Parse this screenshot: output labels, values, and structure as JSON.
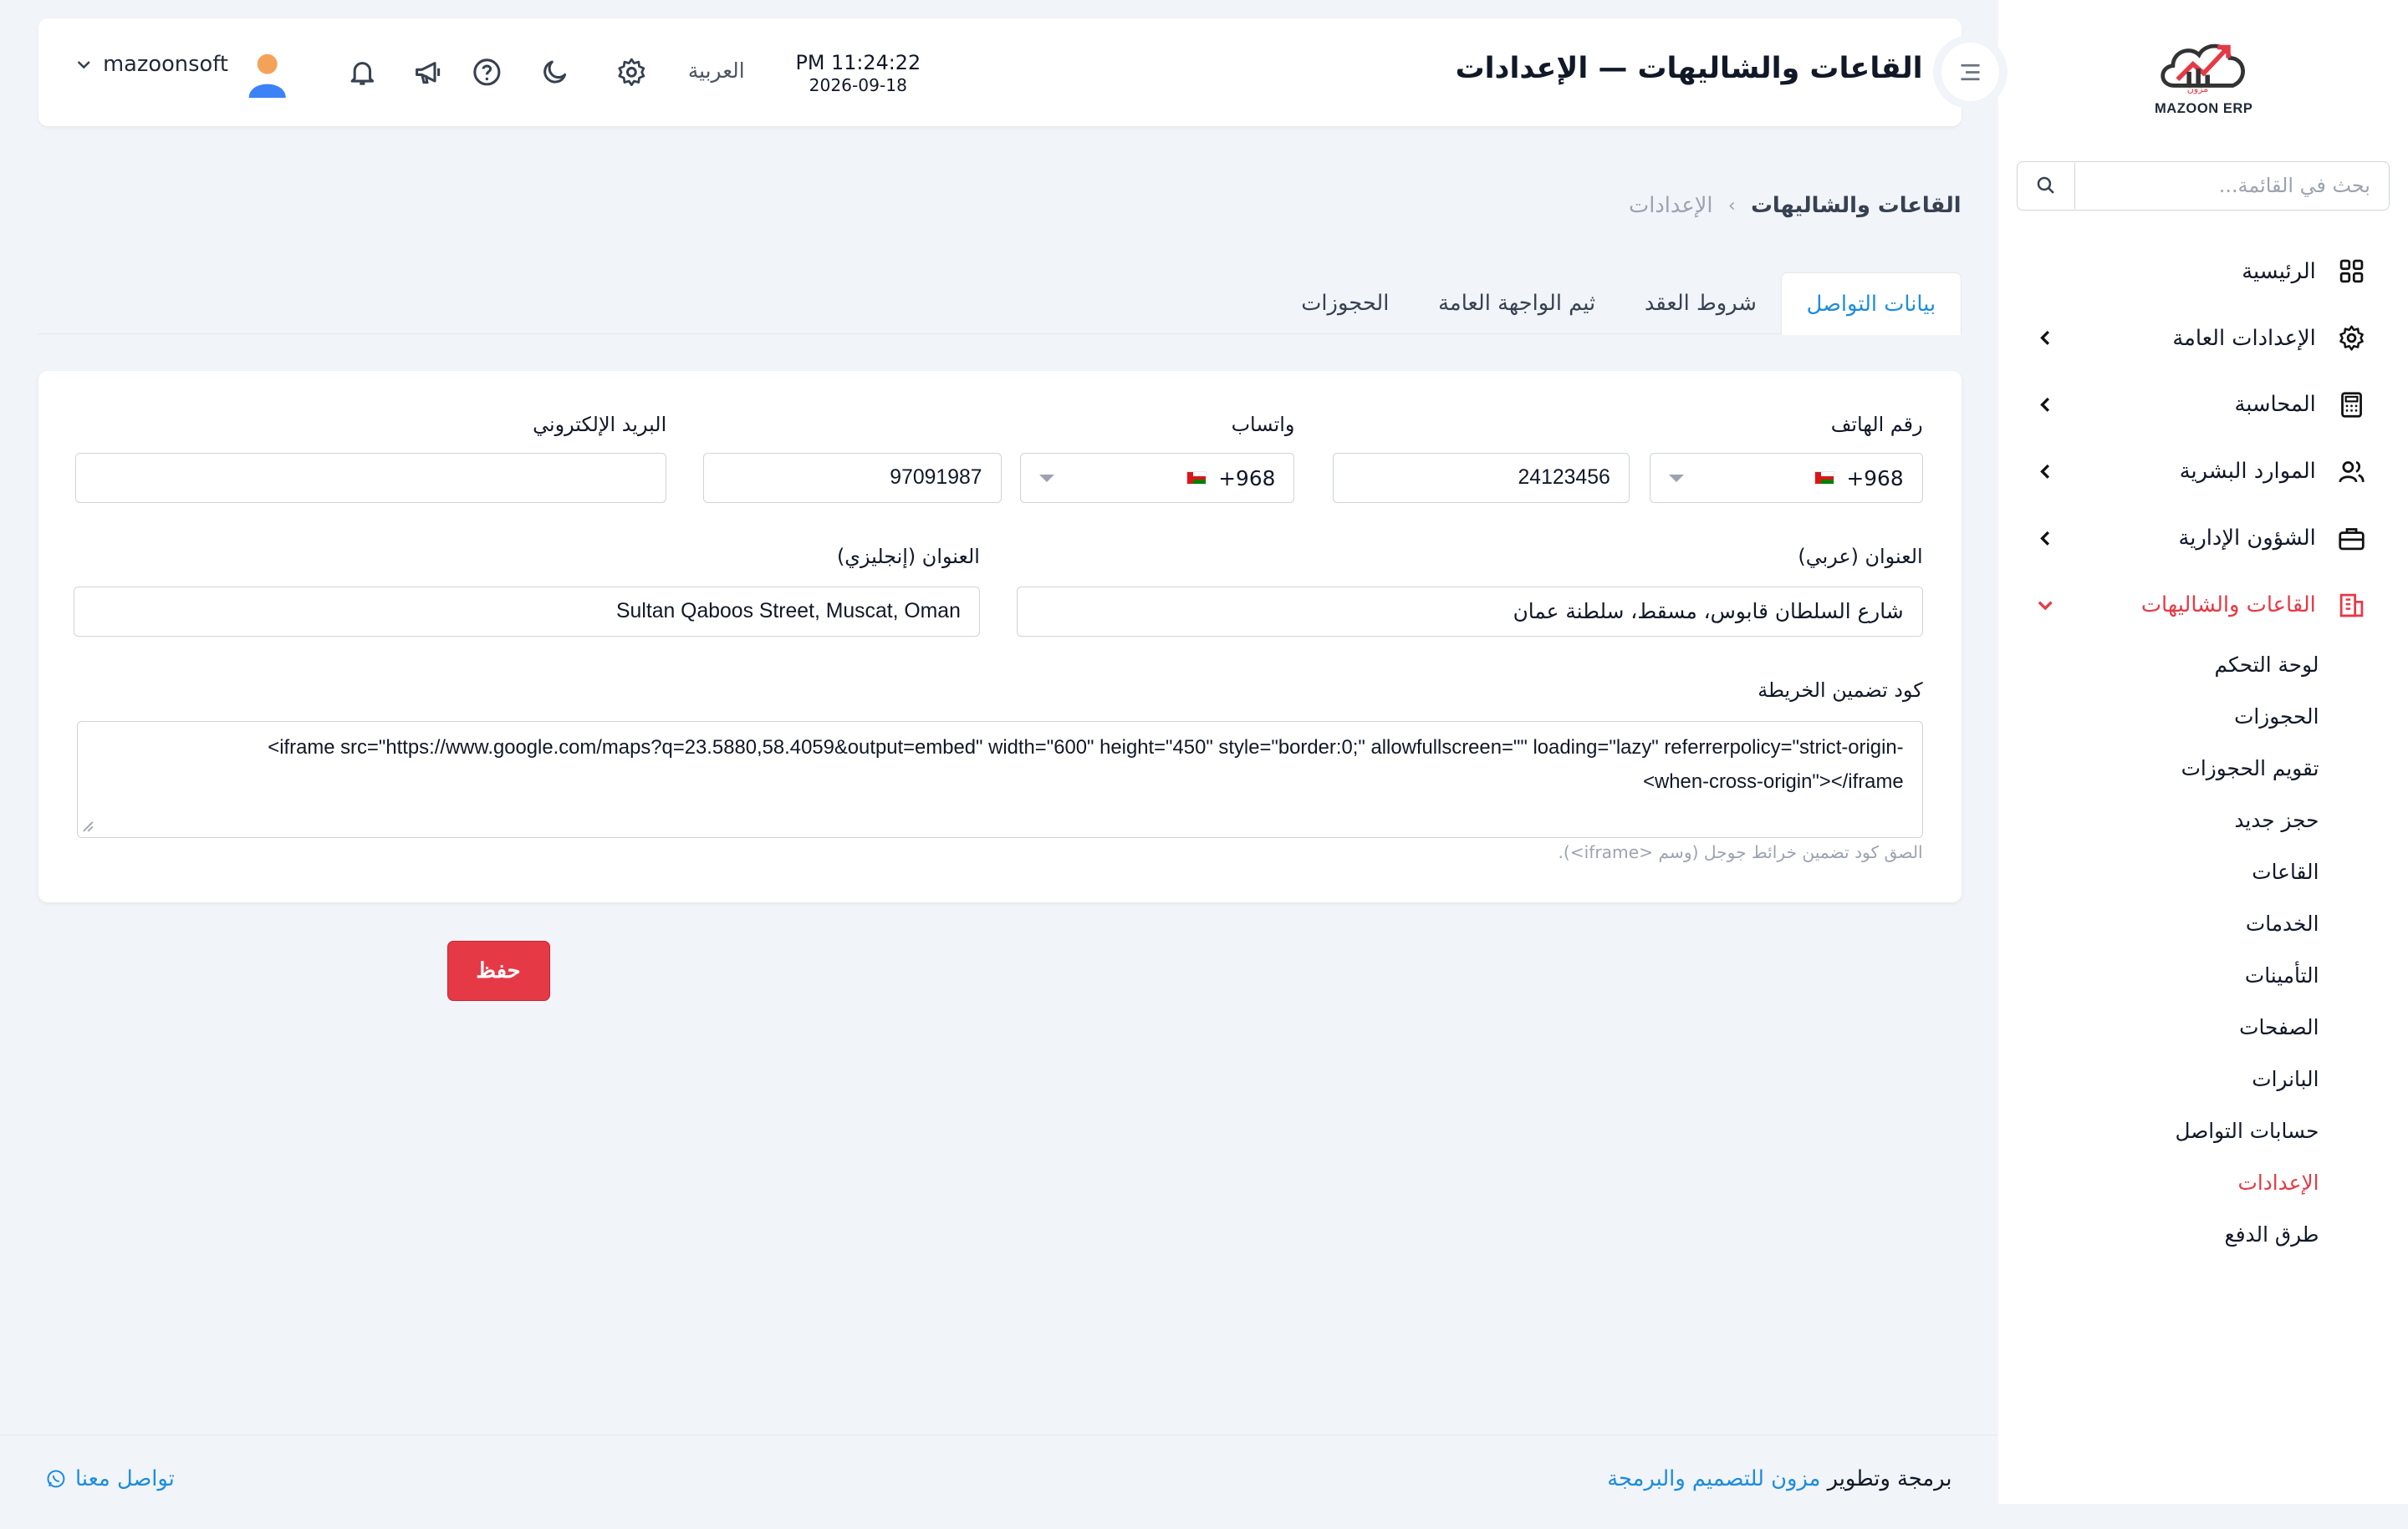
{
  "brand": {
    "logo_text": "MAZOON ERP",
    "logo_small": "مزون"
  },
  "colors": {
    "accent": "#e63946",
    "link": "#1d8cdc"
  },
  "sidebar": {
    "search_placeholder": "بحث في القائمة...",
    "items": [
      {
        "label": "الرئيسية",
        "icon": "grid-icon"
      },
      {
        "label": "الإعدادات العامة",
        "icon": "gear-icon"
      },
      {
        "label": "المحاسبة",
        "icon": "calculator-icon"
      },
      {
        "label": "الموارد البشرية",
        "icon": "users-icon"
      },
      {
        "label": "الشؤون الإدارية",
        "icon": "briefcase-icon"
      },
      {
        "label": "القاعات والشاليهات",
        "icon": "building-icon"
      }
    ],
    "submenu": [
      "لوحة التحكم",
      "الحجوزات",
      "تقويم الحجوزات",
      "حجز جديد",
      "القاعات",
      "الخدمات",
      "التأمينات",
      "الصفحات",
      "البانرات",
      "حسابات التواصل",
      "الإعدادات",
      "طرق الدفع"
    ]
  },
  "header": {
    "title": "القاعات والشاليهات — الإعدادات",
    "time": "PM 11:24:22",
    "date": "2026-09-18",
    "language": "العربية",
    "username": "mazoonsoft"
  },
  "breadcrumb": {
    "current": "القاعات والشاليهات",
    "separator": "›",
    "parent": "الإعدادات"
  },
  "tabs": [
    "بيانات التواصل",
    "شروط العقد",
    "ثيم الواجهة العامة",
    "الحجوزات"
  ],
  "form": {
    "phone_label": "رقم الهاتف",
    "phone_code": "+968",
    "phone_value": "24123456",
    "whatsapp_label": "واتساب",
    "whatsapp_code": "+968",
    "whatsapp_value": "97091987",
    "email_label": "البريد الإلكتروني",
    "email_value": "",
    "address_ar_label": "العنوان (عربي)",
    "address_ar_value": "شارع السلطان قابوس، مسقط، سلطنة عمان",
    "address_en_label": "العنوان (إنجليزي)",
    "address_en_value": "Sultan Qaboos Street, Muscat, Oman",
    "map_label": "كود تضمين الخريطة",
    "map_line1": "<iframe src=\"https://www.google.com/maps?q=23.5880,58.4059&output=embed\" width=\"600\" height=\"450\" style=\"border:0;\" allowfullscreen=\"\" loading=\"lazy\" referrerpolicy=\"strict-origin-",
    "map_line2": "when-cross-origin\"></iframe>",
    "map_hint": "الصق كود تضمين خرائط جوجل (وسم <iframe>)."
  },
  "save_label": "حفظ",
  "footer": {
    "credit_prefix": "برمجة وتطوير",
    "credit_link": "مزون للتصميم والبرمجة",
    "contact": "تواصل معنا"
  }
}
